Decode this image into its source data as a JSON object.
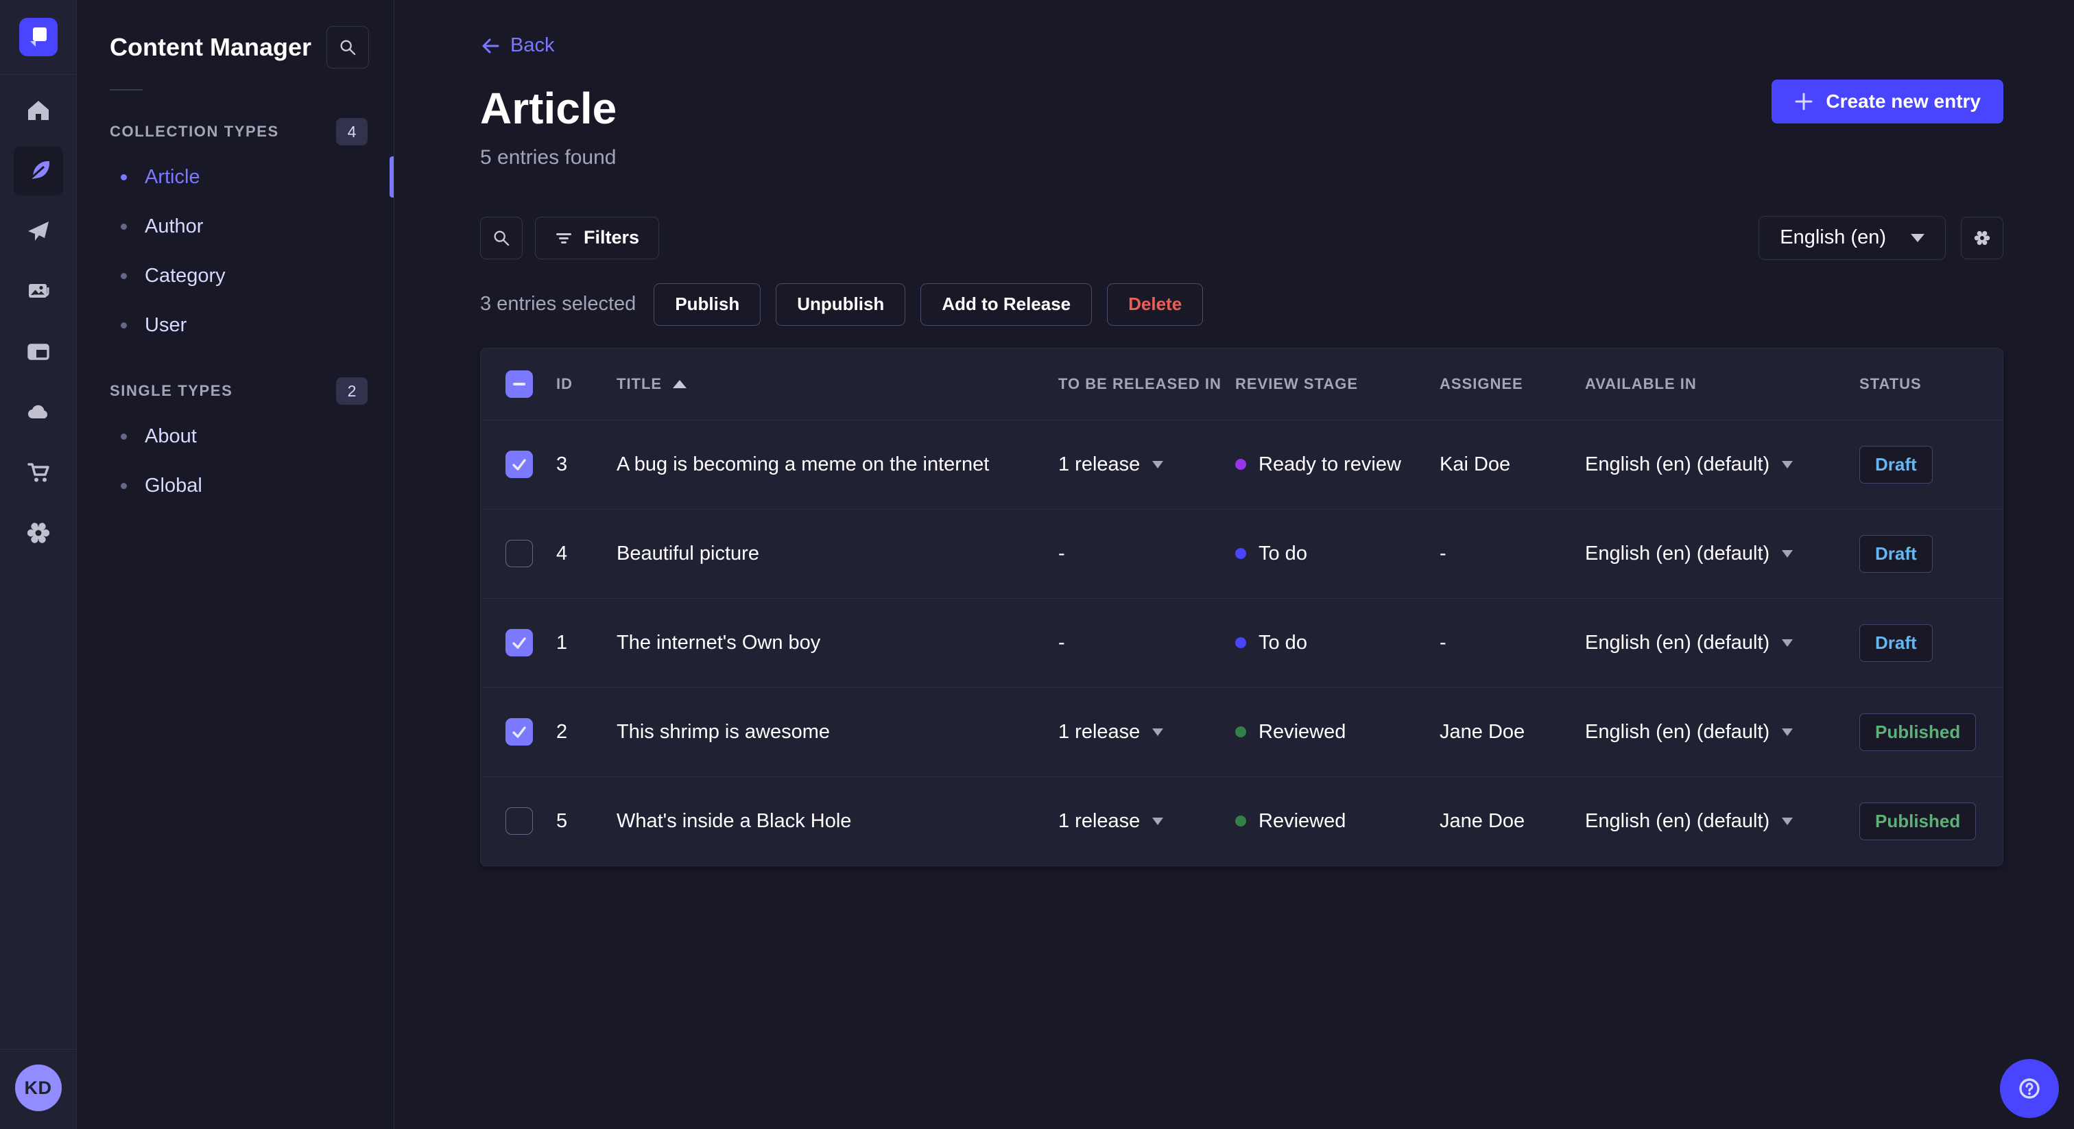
{
  "app": {
    "name": "Strapi",
    "logo_icon": "strapi-logo-icon"
  },
  "rail": {
    "icons": [
      "home-icon",
      "content-manager-icon",
      "releases-icon",
      "media-library-icon",
      "content-type-builder-icon",
      "deploy-icon",
      "marketplace-icon",
      "settings-icon"
    ],
    "active_icon": "content-manager-icon"
  },
  "user": {
    "initials": "KD"
  },
  "sidebar": {
    "title": "Content Manager",
    "search_icon": "search-icon",
    "sections": [
      {
        "label": "COLLECTION TYPES",
        "count": "4",
        "items": [
          {
            "label": "Article",
            "active": true
          },
          {
            "label": "Author",
            "active": false
          },
          {
            "label": "Category",
            "active": false
          },
          {
            "label": "User",
            "active": false
          }
        ]
      },
      {
        "label": "SINGLE TYPES",
        "count": "2",
        "items": [
          {
            "label": "About",
            "active": false
          },
          {
            "label": "Global",
            "active": false
          }
        ]
      }
    ]
  },
  "header": {
    "back_label": "Back",
    "title": "Article",
    "subtitle": "5 entries found",
    "create_button": "Create new entry"
  },
  "toolbar": {
    "search_icon": "search-icon",
    "filters_label": "Filters",
    "locale_value": "English (en)",
    "settings_icon": "gear-icon"
  },
  "selection": {
    "summary": "3 entries selected",
    "actions": [
      {
        "label": "Publish",
        "variant": "default"
      },
      {
        "label": "Unpublish",
        "variant": "default"
      },
      {
        "label": "Add to Release",
        "variant": "default"
      },
      {
        "label": "Delete",
        "variant": "danger"
      }
    ]
  },
  "table": {
    "columns": {
      "id": "ID",
      "title": "TITLE",
      "release": "TO BE RELEASED IN",
      "stage": "REVIEW STAGE",
      "assignee": "ASSIGNEE",
      "available": "AVAILABLE IN",
      "status": "STATUS"
    },
    "sorted_column": "TITLE",
    "sort_direction": "asc",
    "rows": [
      {
        "checked": true,
        "id": "3",
        "title": "A bug is becoming a meme on the internet",
        "release": "1 release",
        "stage": "Ready to review",
        "assignee": "Kai Doe",
        "available": "English (en) (default)",
        "status": "Draft"
      },
      {
        "checked": false,
        "id": "4",
        "title": "Beautiful picture",
        "release": "-",
        "stage": "To do",
        "assignee": "-",
        "available": "English (en) (default)",
        "status": "Draft"
      },
      {
        "checked": true,
        "id": "1",
        "title": "The internet's Own boy",
        "release": "-",
        "stage": "To do",
        "assignee": "-",
        "available": "English (en) (default)",
        "status": "Draft"
      },
      {
        "checked": true,
        "id": "2",
        "title": "This shrimp is awesome",
        "release": "1 release",
        "stage": "Reviewed",
        "assignee": "Jane Doe",
        "available": "English (en) (default)",
        "status": "Published"
      },
      {
        "checked": false,
        "id": "5",
        "title": "What's inside a Black Hole",
        "release": "1 release",
        "stage": "Reviewed",
        "assignee": "Jane Doe",
        "available": "English (en) (default)",
        "status": "Published"
      }
    ]
  },
  "fab": {
    "icon": "help-icon"
  },
  "colors": {
    "accent": "#4945ff",
    "selection_purple": "#7b79ff",
    "danger": "#ee5e52",
    "stage_dots": {
      "To do": "#4945ff",
      "Ready to review": "#9736e8",
      "Reviewed": "#328048"
    },
    "status_text": {
      "Draft": "#66b7f1",
      "Published": "#5cb176"
    }
  }
}
